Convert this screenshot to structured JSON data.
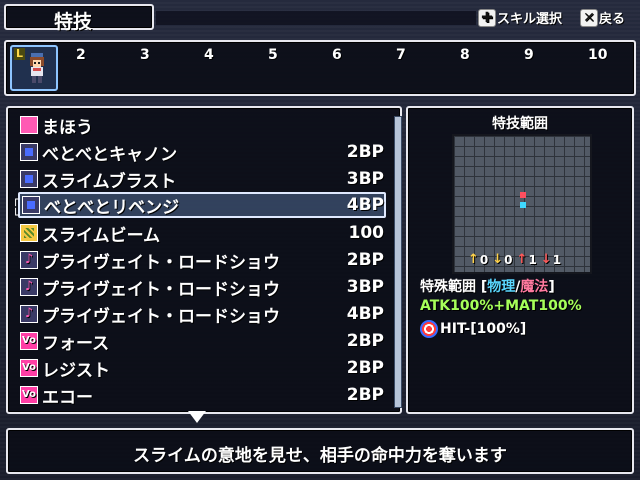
{
  "header": {
    "title": "特技",
    "skill_select_label": "スキル選択",
    "back_label": "戻る"
  },
  "party": {
    "active_badge": "L",
    "slots": [
      "2",
      "3",
      "4",
      "5",
      "6",
      "7",
      "8",
      "9",
      "10"
    ]
  },
  "skills": [
    {
      "name": "まほう",
      "cost": "",
      "icon": "magic-category-icon",
      "color": "#ff5ab4"
    },
    {
      "name": "べとべとキャノン",
      "cost": "2BP",
      "icon": "skill-square-icon",
      "color": "#4a6cff"
    },
    {
      "name": "スライムブラスト",
      "cost": "3BP",
      "icon": "skill-square-icon",
      "color": "#4a6cff"
    },
    {
      "name": "べとべとリベンジ",
      "cost": "4BP",
      "icon": "skill-square-icon",
      "color": "#4a6cff",
      "selected": true
    },
    {
      "name": "スライムビーム",
      "cost": "100",
      "icon": "beam-skill-icon",
      "color": "#f5c842"
    },
    {
      "name": "プライヴェイト・ロードショウ",
      "cost": "2BP",
      "icon": "music-note-icon",
      "color": "#ff5ab4"
    },
    {
      "name": "プライヴェイト・ロードショウ",
      "cost": "3BP",
      "icon": "music-note-plus1-icon",
      "color": "#ff5ab4"
    },
    {
      "name": "プライヴェイト・ロードショウ",
      "cost": "4BP",
      "icon": "music-note-plus2-icon",
      "color": "#ff5ab4"
    },
    {
      "name": "フォース",
      "cost": "2BP",
      "icon": "vo-skill-icon",
      "color": "#ff3ea5"
    },
    {
      "name": "レジスト",
      "cost": "2BP",
      "icon": "vo-skill-icon",
      "color": "#ff3ea5"
    },
    {
      "name": "エコー",
      "cost": "2BP",
      "icon": "vo-skill-icon",
      "color": "#ff3ea5"
    }
  ],
  "range": {
    "title": "特技範囲",
    "modifiers": [
      {
        "arrow": "↑",
        "value": "0",
        "color": "#ffd24a"
      },
      {
        "arrow": "↓",
        "value": "0",
        "color": "#ffd24a"
      },
      {
        "arrow": "↑",
        "value": "1",
        "color": "#ff5a5a"
      },
      {
        "arrow": "↓",
        "value": "1",
        "color": "#ff5a5a"
      }
    ],
    "special_prefix": "特殊範囲 [",
    "phys": "物理",
    "slash": "/",
    "mag": "魔法",
    "special_suffix": "]",
    "atk_formula": "ATK100%+MAT100%",
    "hit": "HIT-[100%]"
  },
  "description": "スライムの意地を見せ、相手の命中力を奪います"
}
